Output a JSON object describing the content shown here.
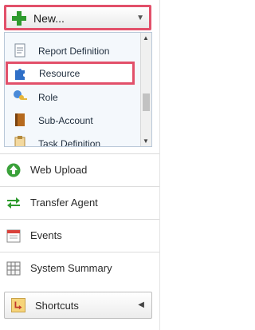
{
  "new_menu": {
    "label": "New...",
    "items": [
      {
        "label": "Report Definition",
        "icon": "report-definition-icon"
      },
      {
        "label": "Resource",
        "icon": "puzzle-piece-icon"
      },
      {
        "label": "Role",
        "icon": "role-key-icon"
      },
      {
        "label": "Sub-Account",
        "icon": "address-book-icon"
      },
      {
        "label": "Task Definition",
        "icon": "task-clipboard-icon"
      }
    ]
  },
  "nav": [
    {
      "label": "Web Upload",
      "icon": "upload-arrow-icon"
    },
    {
      "label": "Transfer Agent",
      "icon": "transfer-arrows-icon"
    },
    {
      "label": "Events",
      "icon": "calendar-icon"
    },
    {
      "label": "System Summary",
      "icon": "grid-summary-icon"
    }
  ],
  "shortcuts": {
    "label": "Shortcuts",
    "icon": "shortcut-arrow-icon"
  },
  "colors": {
    "highlight": "#e2506a",
    "plus": "#2e9a2e"
  }
}
